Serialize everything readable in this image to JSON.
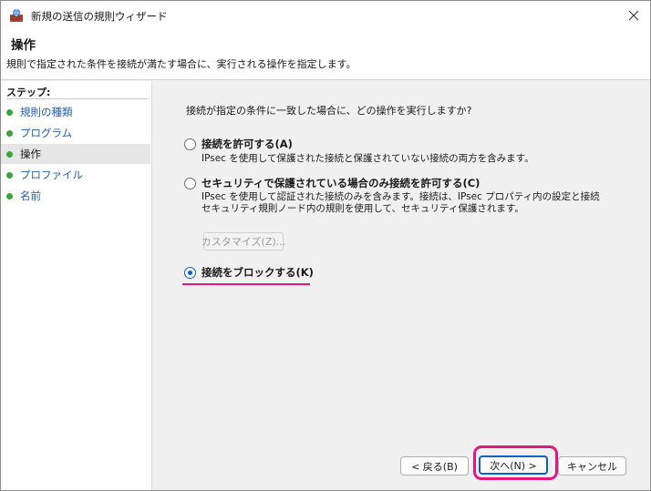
{
  "window": {
    "title": "新規の送信の規則ウィザード"
  },
  "header": {
    "title": "操作",
    "description": "規則で指定された条件を接続が満たす場合に、実行される操作を指定します。"
  },
  "sidebar": {
    "steps_label": "ステップ:",
    "items": [
      {
        "label": "規則の種類"
      },
      {
        "label": "プログラム"
      },
      {
        "label": "操作"
      },
      {
        "label": "プロファイル"
      },
      {
        "label": "名前"
      }
    ],
    "current_index": 2
  },
  "main": {
    "question": "接続が指定の条件に一致した場合に、どの操作を実行しますか?",
    "options": [
      {
        "label": "接続を許可する(A)",
        "description": [
          "IPsec を使用して保護された接続と保護されていない接続の両方を含みます。"
        ],
        "checked": false
      },
      {
        "label": "セキュリティで保護されている場合のみ接続を許可する(C)",
        "description": [
          "IPsec を使用して認証された接続のみを含みます。接続は、IPsec プロパティ内の設定と接続",
          "セキュリティ規則ノード内の規則を使用して、セキュリティ保護されます。"
        ],
        "checked": false
      },
      {
        "label": "接続をブロックする(K)",
        "description": [],
        "checked": true
      }
    ],
    "customize_label": "カスタマイズ(Z)..."
  },
  "footer": {
    "back_label": "< 戻る(B)",
    "next_label": "次へ(N) >",
    "cancel_label": "キャンセル"
  },
  "colors": {
    "accent": "#0a62c4",
    "highlight": "#e4177d",
    "step_dot": "#38a63a",
    "link": "#1f5fb8"
  }
}
